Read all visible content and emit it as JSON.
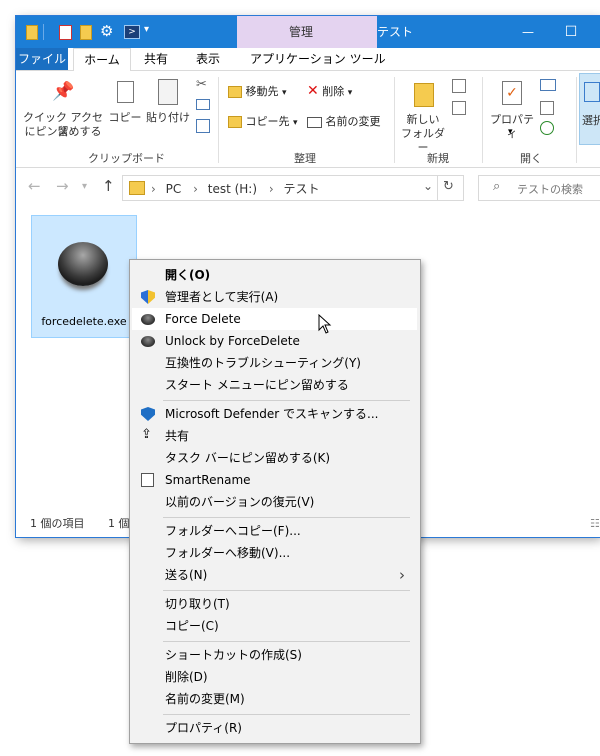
{
  "window": {
    "context_tab_label": "管理",
    "title": "テスト",
    "minimize": "—",
    "maximize": "☐"
  },
  "ribbon_tabs": [
    "ファイル",
    "ホーム",
    "共有",
    "表示",
    "アプリケーション ツール"
  ],
  "ribbon": {
    "clipboard": {
      "quick_access_line1": "クイック アクセス",
      "quick_access_line2": "にピン留めする",
      "copy": "コピー",
      "paste": "貼り付け",
      "label": "クリップボード"
    },
    "organize": {
      "move_to": "移動先",
      "copy_to": "コピー先",
      "delete": "削除",
      "rename": "名前の変更",
      "label": "整理"
    },
    "new": {
      "new_folder_line1": "新しい",
      "new_folder_line2": "フォルダー",
      "label": "新規"
    },
    "open": {
      "properties": "プロパティ",
      "label": "開く"
    },
    "select": {
      "select": "選択"
    }
  },
  "address": {
    "path": [
      "PC",
      "test (H:)",
      "テスト"
    ],
    "search_placeholder": "テストの検索"
  },
  "file": {
    "name": "forcedelete.exe"
  },
  "status": {
    "items": "1 個の項目",
    "selected": "1 個"
  },
  "context_menu": {
    "items": [
      {
        "label": "開く(O)"
      },
      {
        "label": "管理者として実行(A)"
      },
      {
        "label": "Force Delete"
      },
      {
        "label": "Unlock by ForceDelete"
      },
      {
        "label": "互換性のトラブルシューティング(Y)"
      },
      {
        "label": "スタート メニューにピン留めする"
      },
      {
        "label": "Microsoft Defender でスキャンする..."
      },
      {
        "label": "共有"
      },
      {
        "label": "タスク バーにピン留めする(K)"
      },
      {
        "label": "SmartRename"
      },
      {
        "label": "以前のバージョンの復元(V)"
      },
      {
        "label": "フォルダーへコピー(F)..."
      },
      {
        "label": "フォルダーへ移動(V)..."
      },
      {
        "label": "送る(N)"
      },
      {
        "label": "切り取り(T)"
      },
      {
        "label": "コピー(C)"
      },
      {
        "label": "ショートカットの作成(S)"
      },
      {
        "label": "削除(D)"
      },
      {
        "label": "名前の変更(M)"
      },
      {
        "label": "プロパティ(R)"
      }
    ]
  },
  "colors": {
    "titlebar": "#1c7ed6",
    "context_tab": "#e4d3f0",
    "selection": "#cce8ff"
  }
}
